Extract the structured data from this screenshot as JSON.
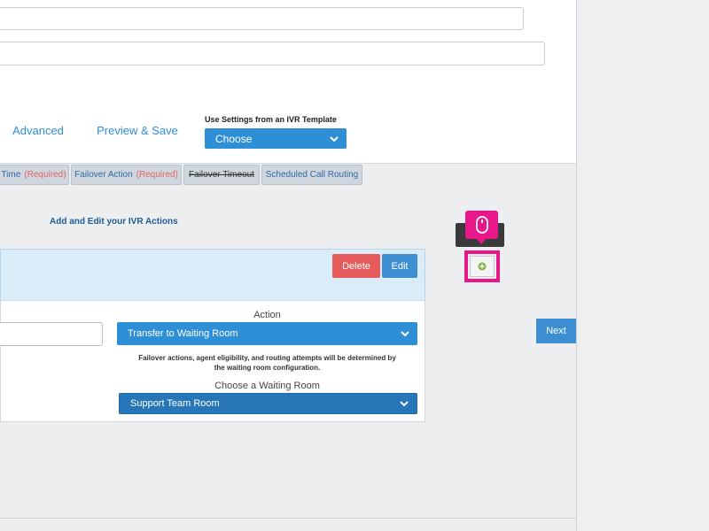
{
  "header_tabs": {
    "advanced_label": "Advanced",
    "preview_label": "Preview & Save"
  },
  "template": {
    "label": "Use Settings from an IVR Template",
    "selected": "Choose"
  },
  "subtabs": [
    {
      "label": "Time",
      "required": "(Required)"
    },
    {
      "label": "Failover Action",
      "required": "(Required)"
    },
    {
      "label": "Failover Timeout"
    },
    {
      "label": "Scheduled Call Routing"
    }
  ],
  "section": {
    "title": "Add and Edit your IVR Actions"
  },
  "action_card": {
    "delete_label": "Delete",
    "edit_label": "Edit",
    "action_label": "Action",
    "action_selected": "Transfer to Waiting Room",
    "note_line1": "Failover actions, agent eligibility, and routing attempts will be determined by",
    "note_line2": "the waiting room configuration.",
    "waiting_room_label": "Choose a Waiting Room",
    "waiting_room_selected": "Support Team Room"
  },
  "next_label": "Next",
  "colors": {
    "accent": "#2f8fd6",
    "danger": "#e55b5b",
    "highlight": "#e8178a",
    "required": "#e06666"
  },
  "icons": {
    "add": "plus-circle-icon",
    "mouse": "mouse-icon",
    "dropdown": "chevron-down-icon"
  }
}
